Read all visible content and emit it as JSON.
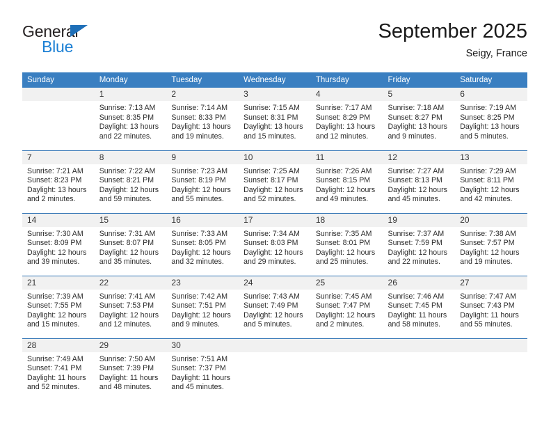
{
  "brand": {
    "word1": "General",
    "word2": "Blue",
    "triangle_color": "#1e6fb8",
    "word2_color": "#1b7fd4"
  },
  "header": {
    "title": "September 2025",
    "location": "Seigy, France"
  },
  "theme": {
    "header_bg": "#3a7fc1",
    "row_divider": "#2e72b4",
    "daynum_bg": "#f1f1f1"
  },
  "calendar": {
    "weekday_headers": [
      "Sunday",
      "Monday",
      "Tuesday",
      "Wednesday",
      "Thursday",
      "Friday",
      "Saturday"
    ],
    "weeks": [
      [
        {
          "day": "",
          "sunrise": "",
          "sunset": "",
          "daylight1": "",
          "daylight2": ""
        },
        {
          "day": "1",
          "sunrise": "Sunrise: 7:13 AM",
          "sunset": "Sunset: 8:35 PM",
          "daylight1": "Daylight: 13 hours",
          "daylight2": "and 22 minutes."
        },
        {
          "day": "2",
          "sunrise": "Sunrise: 7:14 AM",
          "sunset": "Sunset: 8:33 PM",
          "daylight1": "Daylight: 13 hours",
          "daylight2": "and 19 minutes."
        },
        {
          "day": "3",
          "sunrise": "Sunrise: 7:15 AM",
          "sunset": "Sunset: 8:31 PM",
          "daylight1": "Daylight: 13 hours",
          "daylight2": "and 15 minutes."
        },
        {
          "day": "4",
          "sunrise": "Sunrise: 7:17 AM",
          "sunset": "Sunset: 8:29 PM",
          "daylight1": "Daylight: 13 hours",
          "daylight2": "and 12 minutes."
        },
        {
          "day": "5",
          "sunrise": "Sunrise: 7:18 AM",
          "sunset": "Sunset: 8:27 PM",
          "daylight1": "Daylight: 13 hours",
          "daylight2": "and 9 minutes."
        },
        {
          "day": "6",
          "sunrise": "Sunrise: 7:19 AM",
          "sunset": "Sunset: 8:25 PM",
          "daylight1": "Daylight: 13 hours",
          "daylight2": "and 5 minutes."
        }
      ],
      [
        {
          "day": "7",
          "sunrise": "Sunrise: 7:21 AM",
          "sunset": "Sunset: 8:23 PM",
          "daylight1": "Daylight: 13 hours",
          "daylight2": "and 2 minutes."
        },
        {
          "day": "8",
          "sunrise": "Sunrise: 7:22 AM",
          "sunset": "Sunset: 8:21 PM",
          "daylight1": "Daylight: 12 hours",
          "daylight2": "and 59 minutes."
        },
        {
          "day": "9",
          "sunrise": "Sunrise: 7:23 AM",
          "sunset": "Sunset: 8:19 PM",
          "daylight1": "Daylight: 12 hours",
          "daylight2": "and 55 minutes."
        },
        {
          "day": "10",
          "sunrise": "Sunrise: 7:25 AM",
          "sunset": "Sunset: 8:17 PM",
          "daylight1": "Daylight: 12 hours",
          "daylight2": "and 52 minutes."
        },
        {
          "day": "11",
          "sunrise": "Sunrise: 7:26 AM",
          "sunset": "Sunset: 8:15 PM",
          "daylight1": "Daylight: 12 hours",
          "daylight2": "and 49 minutes."
        },
        {
          "day": "12",
          "sunrise": "Sunrise: 7:27 AM",
          "sunset": "Sunset: 8:13 PM",
          "daylight1": "Daylight: 12 hours",
          "daylight2": "and 45 minutes."
        },
        {
          "day": "13",
          "sunrise": "Sunrise: 7:29 AM",
          "sunset": "Sunset: 8:11 PM",
          "daylight1": "Daylight: 12 hours",
          "daylight2": "and 42 minutes."
        }
      ],
      [
        {
          "day": "14",
          "sunrise": "Sunrise: 7:30 AM",
          "sunset": "Sunset: 8:09 PM",
          "daylight1": "Daylight: 12 hours",
          "daylight2": "and 39 minutes."
        },
        {
          "day": "15",
          "sunrise": "Sunrise: 7:31 AM",
          "sunset": "Sunset: 8:07 PM",
          "daylight1": "Daylight: 12 hours",
          "daylight2": "and 35 minutes."
        },
        {
          "day": "16",
          "sunrise": "Sunrise: 7:33 AM",
          "sunset": "Sunset: 8:05 PM",
          "daylight1": "Daylight: 12 hours",
          "daylight2": "and 32 minutes."
        },
        {
          "day": "17",
          "sunrise": "Sunrise: 7:34 AM",
          "sunset": "Sunset: 8:03 PM",
          "daylight1": "Daylight: 12 hours",
          "daylight2": "and 29 minutes."
        },
        {
          "day": "18",
          "sunrise": "Sunrise: 7:35 AM",
          "sunset": "Sunset: 8:01 PM",
          "daylight1": "Daylight: 12 hours",
          "daylight2": "and 25 minutes."
        },
        {
          "day": "19",
          "sunrise": "Sunrise: 7:37 AM",
          "sunset": "Sunset: 7:59 PM",
          "daylight1": "Daylight: 12 hours",
          "daylight2": "and 22 minutes."
        },
        {
          "day": "20",
          "sunrise": "Sunrise: 7:38 AM",
          "sunset": "Sunset: 7:57 PM",
          "daylight1": "Daylight: 12 hours",
          "daylight2": "and 19 minutes."
        }
      ],
      [
        {
          "day": "21",
          "sunrise": "Sunrise: 7:39 AM",
          "sunset": "Sunset: 7:55 PM",
          "daylight1": "Daylight: 12 hours",
          "daylight2": "and 15 minutes."
        },
        {
          "day": "22",
          "sunrise": "Sunrise: 7:41 AM",
          "sunset": "Sunset: 7:53 PM",
          "daylight1": "Daylight: 12 hours",
          "daylight2": "and 12 minutes."
        },
        {
          "day": "23",
          "sunrise": "Sunrise: 7:42 AM",
          "sunset": "Sunset: 7:51 PM",
          "daylight1": "Daylight: 12 hours",
          "daylight2": "and 9 minutes."
        },
        {
          "day": "24",
          "sunrise": "Sunrise: 7:43 AM",
          "sunset": "Sunset: 7:49 PM",
          "daylight1": "Daylight: 12 hours",
          "daylight2": "and 5 minutes."
        },
        {
          "day": "25",
          "sunrise": "Sunrise: 7:45 AM",
          "sunset": "Sunset: 7:47 PM",
          "daylight1": "Daylight: 12 hours",
          "daylight2": "and 2 minutes."
        },
        {
          "day": "26",
          "sunrise": "Sunrise: 7:46 AM",
          "sunset": "Sunset: 7:45 PM",
          "daylight1": "Daylight: 11 hours",
          "daylight2": "and 58 minutes."
        },
        {
          "day": "27",
          "sunrise": "Sunrise: 7:47 AM",
          "sunset": "Sunset: 7:43 PM",
          "daylight1": "Daylight: 11 hours",
          "daylight2": "and 55 minutes."
        }
      ],
      [
        {
          "day": "28",
          "sunrise": "Sunrise: 7:49 AM",
          "sunset": "Sunset: 7:41 PM",
          "daylight1": "Daylight: 11 hours",
          "daylight2": "and 52 minutes."
        },
        {
          "day": "29",
          "sunrise": "Sunrise: 7:50 AM",
          "sunset": "Sunset: 7:39 PM",
          "daylight1": "Daylight: 11 hours",
          "daylight2": "and 48 minutes."
        },
        {
          "day": "30",
          "sunrise": "Sunrise: 7:51 AM",
          "sunset": "Sunset: 7:37 PM",
          "daylight1": "Daylight: 11 hours",
          "daylight2": "and 45 minutes."
        },
        {
          "day": "",
          "sunrise": "",
          "sunset": "",
          "daylight1": "",
          "daylight2": ""
        },
        {
          "day": "",
          "sunrise": "",
          "sunset": "",
          "daylight1": "",
          "daylight2": ""
        },
        {
          "day": "",
          "sunrise": "",
          "sunset": "",
          "daylight1": "",
          "daylight2": ""
        },
        {
          "day": "",
          "sunrise": "",
          "sunset": "",
          "daylight1": "",
          "daylight2": ""
        }
      ]
    ]
  }
}
